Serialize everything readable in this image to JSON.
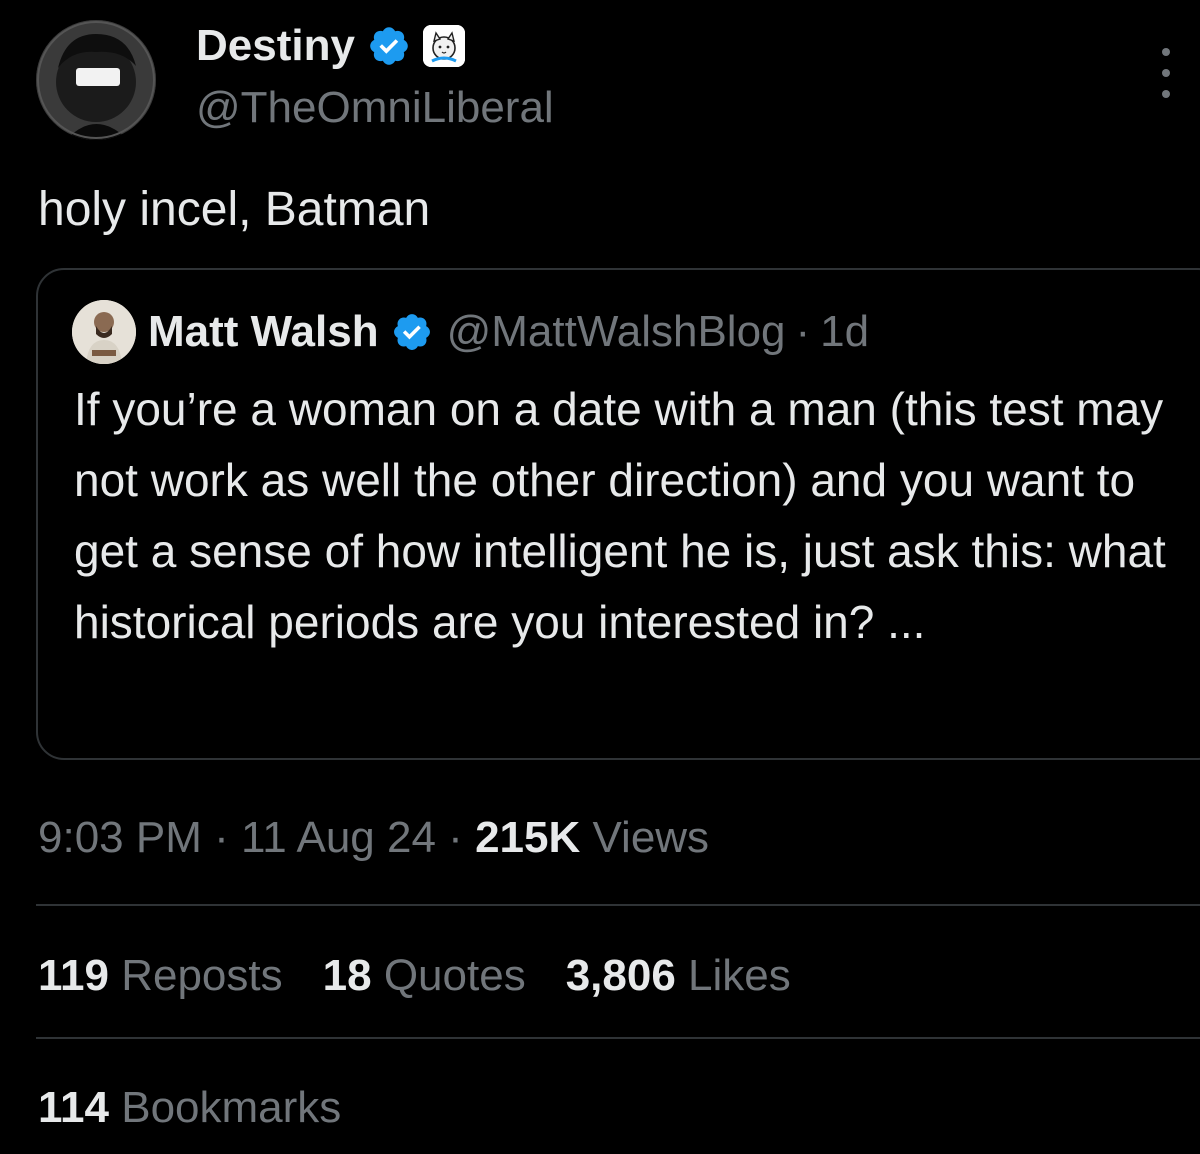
{
  "author": {
    "name": "Destiny",
    "handle": "@TheOmniLiberal",
    "verified_color": "#1d9bf0"
  },
  "tweet": {
    "text": "holy incel, Batman"
  },
  "quoted": {
    "name": "Matt Walsh",
    "handle": "@MattWalshBlog",
    "separator": "·",
    "time": "1d",
    "text": "If you’re a woman on a date with a man (this test may not work as well the other direction) and you want to get a sense of how intelligent he is, just ask this: what historical periods are you interested in? ..."
  },
  "meta": {
    "time": "9:03 PM",
    "sep1": "·",
    "date": "11 Aug 24",
    "sep2": "·",
    "views_count": "215K",
    "views_label": "Views"
  },
  "stats": {
    "reposts_count": "119",
    "reposts_label": "Reposts",
    "quotes_count": "18",
    "quotes_label": "Quotes",
    "likes_count": "3,806",
    "likes_label": "Likes",
    "bookmarks_count": "114",
    "bookmarks_label": "Bookmarks"
  },
  "icons": {
    "verified": "verified-badge-icon",
    "affiliate": "affiliate-badge-icon",
    "more": "more-options-icon"
  }
}
